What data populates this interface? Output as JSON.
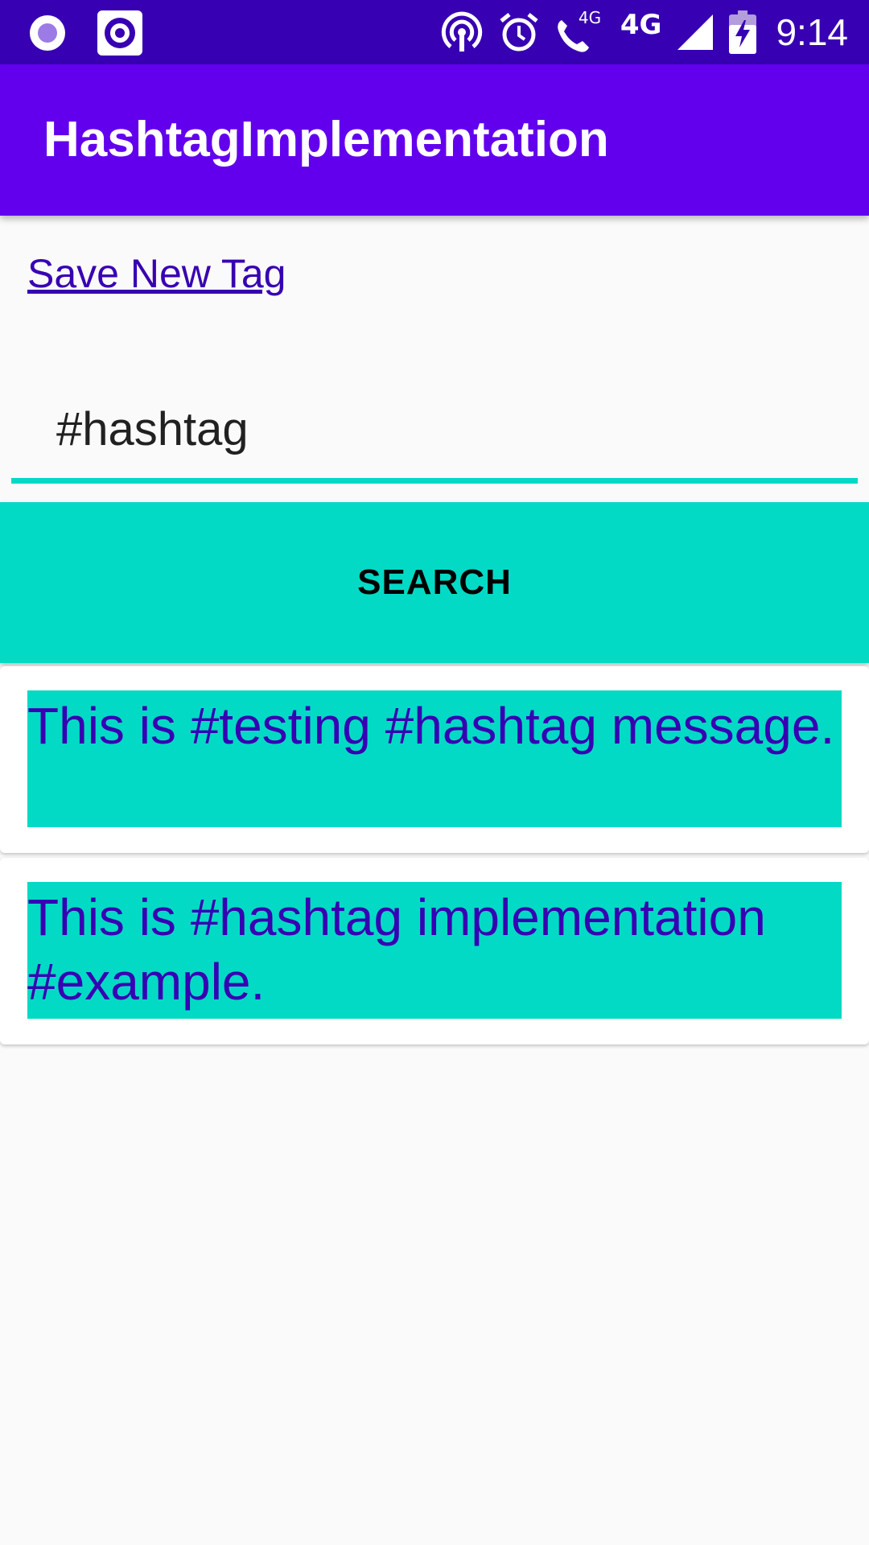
{
  "status_bar": {
    "time": "9:14",
    "network_label": "4G",
    "icons": [
      "radio-app-icon",
      "circle-app-icon",
      "hotspot-icon",
      "alarm-icon",
      "volte-call-icon",
      "network-4g-icon",
      "signal-icon",
      "battery-charging-icon"
    ],
    "volte_label": "4G"
  },
  "app_bar": {
    "title": "HashtagImplementation"
  },
  "save_link": {
    "label": "Save New Tag"
  },
  "search": {
    "input_value": "#hashtag",
    "button_label": "SEARCH"
  },
  "messages": [
    {
      "text": "This is #testing #hashtag message."
    },
    {
      "text": "This is #hashtag implementation #example."
    }
  ],
  "colors": {
    "status_bar": "#3700b3",
    "app_bar": "#6200ee",
    "accent": "#03dac5",
    "message_text": "#3700b3"
  }
}
